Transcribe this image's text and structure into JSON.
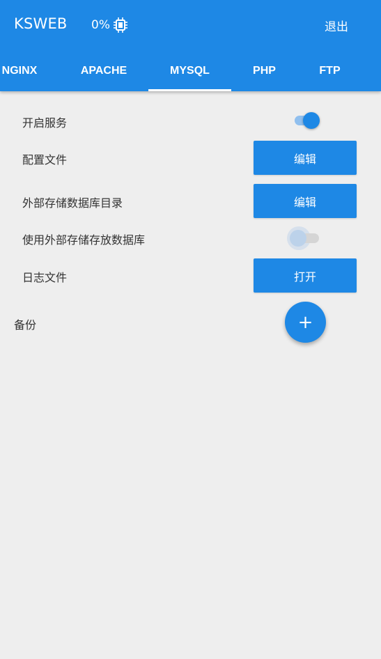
{
  "header": {
    "title": "KSWEB",
    "cpu_usage": "0%",
    "exit_label": "退出"
  },
  "tabs": [
    {
      "label": "NGINX",
      "active": false
    },
    {
      "label": "APACHE",
      "active": false
    },
    {
      "label": "MYSQL",
      "active": true
    },
    {
      "label": "PHP",
      "active": false
    },
    {
      "label": "FTP",
      "active": false
    }
  ],
  "settings": {
    "start_service": {
      "label": "开启服务",
      "enabled": true
    },
    "config_file": {
      "label": "配置文件",
      "button": "编辑"
    },
    "external_db_dir": {
      "label": "外部存储数据库目录",
      "button": "编辑"
    },
    "use_external_storage": {
      "label": "使用外部存储存放数据库",
      "enabled": false
    },
    "log_file": {
      "label": "日志文件",
      "button": "打开"
    }
  },
  "backup": {
    "label": "备份",
    "add_button": "+"
  },
  "colors": {
    "primary": "#1e88e5",
    "background": "#eeeeee"
  }
}
